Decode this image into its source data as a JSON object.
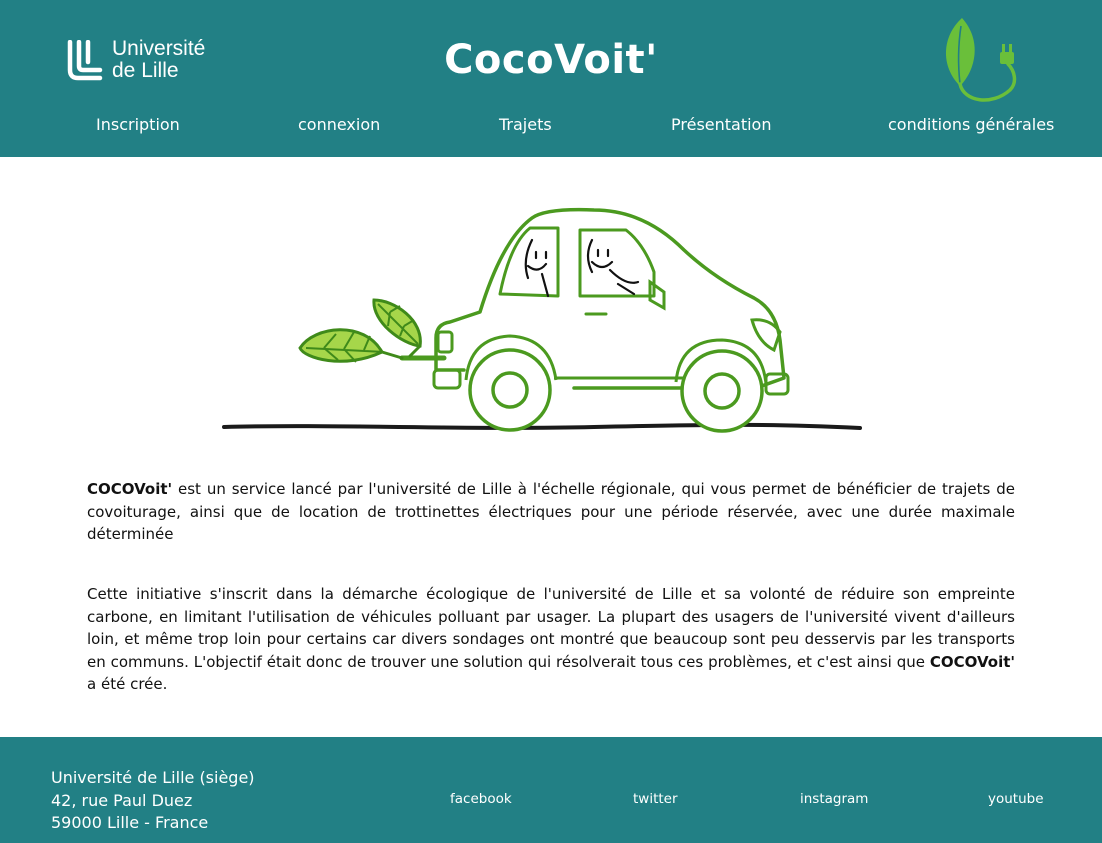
{
  "header": {
    "university": {
      "line1": "Université",
      "line2": "de Lille"
    },
    "brand": "CocoVoit'",
    "nav": [
      {
        "label": "Inscription"
      },
      {
        "label": "connexion"
      },
      {
        "label": "Trajets"
      },
      {
        "label": "Présentation"
      },
      {
        "label": "conditions générales"
      }
    ]
  },
  "content": {
    "p1": {
      "brand": "COCOVoit'",
      "text": " est un service lancé par l'université de Lille à l'échelle régionale, qui vous permet de bénéficier de trajets de covoiturage, ainsi que de location de trottinettes électriques pour une période réservée, avec une durée maximale déterminée"
    },
    "p2": {
      "text": "Cette initiative s'inscrit dans la démarche écologique de l'université de Lille et sa volonté de réduire son empreinte carbone, en limitant l'utilisation de véhicules polluant par usager. La plupart des usagers de l'université vivent d'ailleurs loin, et même trop loin pour certains car divers sondages ont montré que beaucoup sont peu desservis par les transports en communs. L'objectif était donc de trouver une solution qui résolverait tous ces problèmes, et c'est ainsi que ",
      "brand": "COCOVoit'",
      "suffix": " a été crée."
    }
  },
  "footer": {
    "address": {
      "line1": "Université de Lille (siège)",
      "line2": "42, rue Paul Duez",
      "line3": "59000 Lille - France"
    },
    "social": [
      {
        "label": "facebook"
      },
      {
        "label": "twitter"
      },
      {
        "label": "instagram"
      },
      {
        "label": "youtube"
      }
    ]
  },
  "colors": {
    "primary": "#228085",
    "leaf": "#6abf3a",
    "car_outline": "#4b9a1f"
  },
  "icons": [
    "university-logo-icon",
    "leaf-plug-icon",
    "eco-car-illustration"
  ]
}
